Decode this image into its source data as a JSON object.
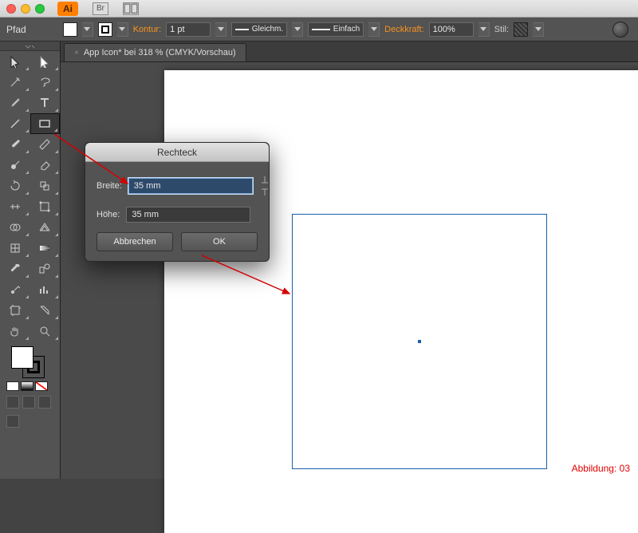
{
  "titlebar": {
    "app": "Ai"
  },
  "controlbar": {
    "kind": "Pfad",
    "stroke_label": "Kontur:",
    "stroke_value": "1 pt",
    "stroke_type": "Gleichm.",
    "profile": "Einfach",
    "opacity_label": "Deckkraft:",
    "opacity_value": "100%",
    "style_label": "Stil:"
  },
  "tab": {
    "title": "App Icon* bei 318 % (CMYK/Vorschau)"
  },
  "dialog": {
    "title": "Rechteck",
    "width_label": "Breite:",
    "width_value": "35 mm",
    "height_label": "Höhe:",
    "height_value": "35 mm",
    "cancel": "Abbrechen",
    "ok": "OK"
  },
  "footer": {
    "caption": "Abbildung: 03"
  },
  "tools": {
    "names": [
      "selection-tool",
      "direct-selection-tool",
      "magic-wand-tool",
      "lasso-tool",
      "pen-tool",
      "type-tool",
      "line-tool",
      "rectangle-tool",
      "paintbrush-tool",
      "pencil-tool",
      "blob-brush-tool",
      "eraser-tool",
      "rotate-tool",
      "scale-tool",
      "width-tool",
      "free-transform-tool",
      "shape-builder-tool",
      "perspective-grid-tool",
      "mesh-tool",
      "gradient-tool",
      "eyedropper-tool",
      "blend-tool",
      "symbol-sprayer-tool",
      "graph-tool",
      "artboard-tool",
      "slice-tool",
      "hand-tool",
      "zoom-tool"
    ]
  }
}
